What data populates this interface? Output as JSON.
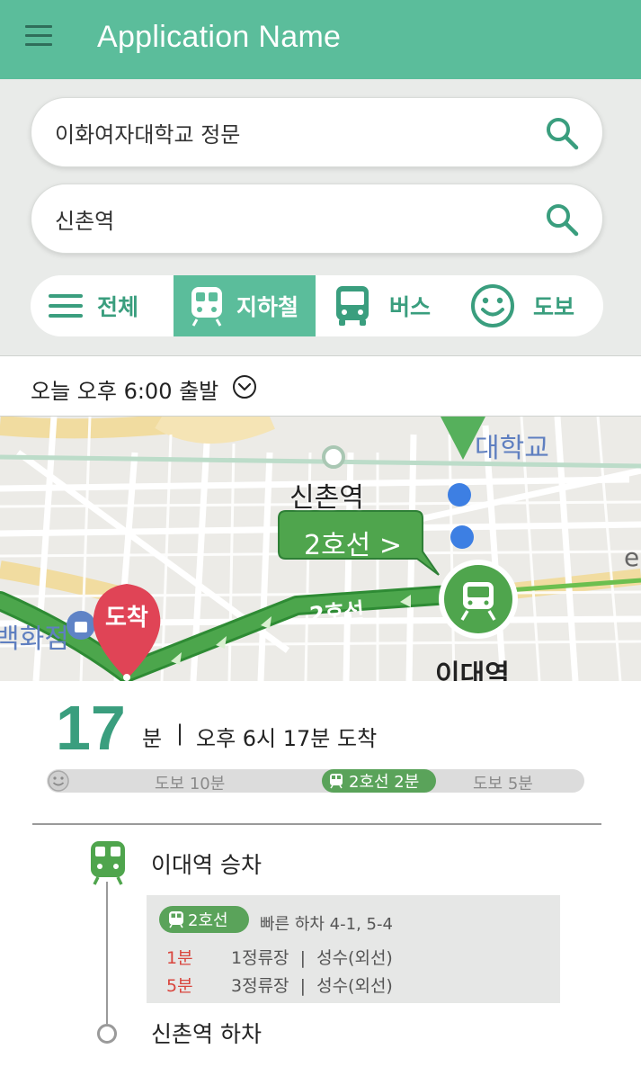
{
  "app_bar": {
    "title": "Application Name",
    "menu_icon": "hamburger-menu-icon",
    "color": "#5bbd9b"
  },
  "search": {
    "origin": {
      "value": "이화여자대학교 정문",
      "icon": "search-icon"
    },
    "destination": {
      "value": "신촌역",
      "icon": "search-icon"
    }
  },
  "modes": [
    {
      "label": "전체",
      "icon": "list-icon",
      "active": false
    },
    {
      "label": "지하철",
      "icon": "subway-icon",
      "active": true
    },
    {
      "label": "버스",
      "icon": "bus-icon",
      "active": false
    },
    {
      "label": "도보",
      "icon": "smiley-walk-icon",
      "active": false
    }
  ],
  "departure": {
    "label": "오늘 오후 6:00 출발",
    "icon": "chevron-down-circle-icon"
  },
  "map": {
    "station_label": "신촌역",
    "university_label": "대학교",
    "line_callout": "2호선 >",
    "line_path_label": "2호선",
    "dept_store_label": "백화점",
    "arrival_marker": "도착",
    "ewha_station_label": "이대역",
    "edge_text": "e"
  },
  "summary": {
    "minutes": "17",
    "unit": "분",
    "separator": "|",
    "arrival": "오후 6시 17분 도착",
    "segments": {
      "walk1": "도보 10분",
      "subway": "2호선 2분",
      "walk2": "도보 5분"
    }
  },
  "steps": {
    "board": "이대역 승차",
    "line_badge": "2호선",
    "fast_exit": "빠른 하차 4-1, 5-4",
    "arrivals": [
      {
        "time": "1분",
        "info": "1정류장  |  성수(외선)"
      },
      {
        "time": "5분",
        "info": "3정류장  |  성수(외선)"
      }
    ],
    "alight": "신촌역 하차"
  },
  "colors": {
    "accent": "#5bbd9b",
    "accent_dark": "#3a9e7e",
    "line2": "#5aa35a",
    "arrival_red": "#d9453d",
    "marker_red": "#e04456"
  }
}
